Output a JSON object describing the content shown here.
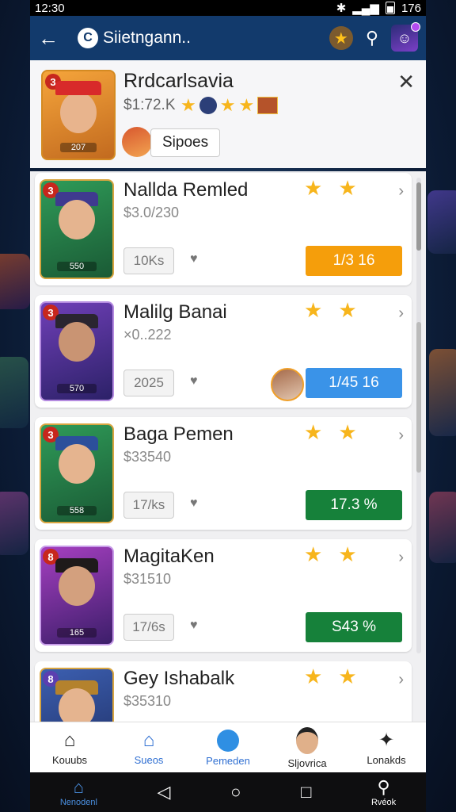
{
  "status": {
    "time": "12:30",
    "battery": "176"
  },
  "topbar": {
    "title": "Siietngann..",
    "logo_letter": "C",
    "back_icon": "arrow-left-icon"
  },
  "header": {
    "name": "Rrdcarlsavia",
    "price": "$1:72.K",
    "level": "3",
    "count": "207",
    "chip_label": "Sipoes",
    "close_icon": "close-icon"
  },
  "cards": [
    {
      "title": "Nallda Remled",
      "sub": "$3.0/230",
      "level": "3",
      "badge": "550",
      "time": "10Ks",
      "pill": "1/3 16",
      "pill_color": "#f59e0b"
    },
    {
      "title": "Malilg Banai",
      "sub": "×0..222",
      "level": "3",
      "badge": "570",
      "time": "2025",
      "pill": "1/45 16",
      "pill_color": "#3a93e8"
    },
    {
      "title": "Baga Pemen",
      "sub": "$33540",
      "level": "3",
      "badge": "558",
      "time": "17/ks",
      "pill": "17.3 %",
      "pill_color": "#16813a"
    },
    {
      "title": "MagitaKen",
      "sub": "$31510",
      "level": "8",
      "badge": "165",
      "time": "17/6s",
      "pill": "S43 %",
      "pill_color": "#16813a"
    },
    {
      "title": "Gey Ishabalk",
      "sub": "$35310",
      "level": "8",
      "badge": "",
      "time": "",
      "pill": "",
      "pill_color": ""
    }
  ],
  "tabs": [
    {
      "label": "Kouubs",
      "icon": "home-icon"
    },
    {
      "label": "Sueos",
      "icon": "house-icon"
    },
    {
      "label": "Pemeden",
      "icon": "globe-icon"
    },
    {
      "label": "Sljovrica",
      "icon": "avatar-icon"
    },
    {
      "label": "Lonakds",
      "icon": "puzzle-icon"
    }
  ],
  "nav": {
    "left_label": "Nenodenl",
    "right_label": "Rvéok"
  }
}
